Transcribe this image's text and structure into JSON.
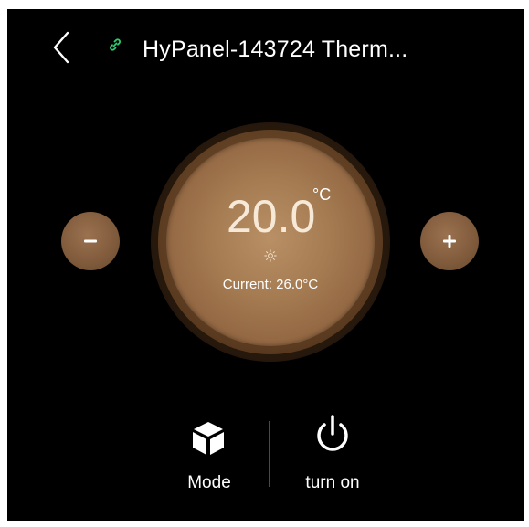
{
  "header": {
    "title": "HyPanel-143724 Therm...",
    "back_icon": "chevron-left-icon",
    "link_icon": "link-icon",
    "link_color": "#2ecc71"
  },
  "thermostat": {
    "setpoint": "20.0",
    "unit": "°C",
    "mode_indicator_icon": "sun-icon",
    "current_text": "Current: 26.0°C",
    "accent_color": "#a57b52"
  },
  "controls": {
    "decrease_label": "−",
    "increase_label": "+",
    "mode": {
      "label": "Mode",
      "icon": "cube-icon"
    },
    "power": {
      "label": "turn on",
      "icon": "power-icon"
    }
  }
}
